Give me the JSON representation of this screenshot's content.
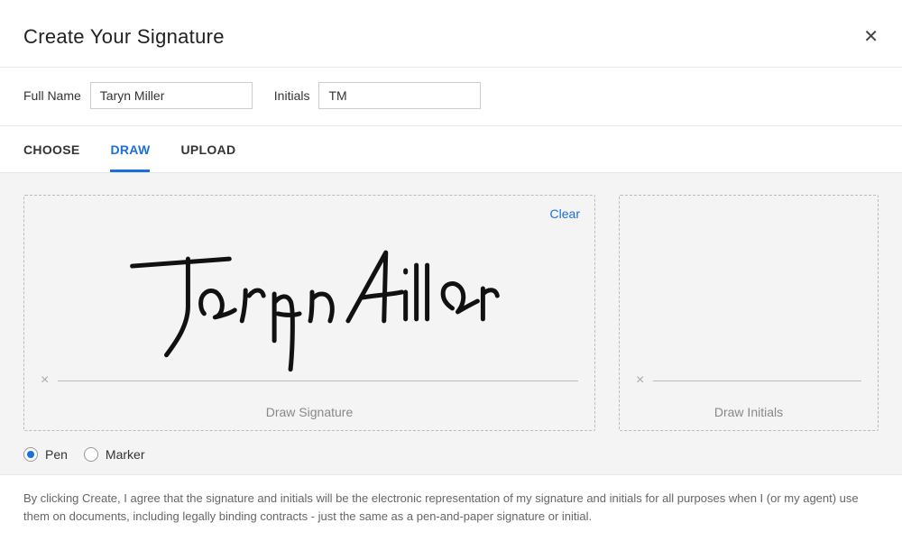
{
  "dialog": {
    "title": "Create Your Signature"
  },
  "fields": {
    "full_name_label": "Full Name",
    "full_name_value": "Taryn Miller",
    "initials_label": "Initials",
    "initials_value": "TM"
  },
  "tabs": {
    "choose": "CHOOSE",
    "draw": "DRAW",
    "upload": "UPLOAD",
    "active": "draw"
  },
  "draw_area": {
    "clear_label": "Clear",
    "signature_caption": "Draw Signature",
    "initials_caption": "Draw Initials",
    "tool_pen": "Pen",
    "tool_marker": "Marker",
    "selected_tool": "pen"
  },
  "footer": {
    "disclaimer": "By clicking Create, I agree that the signature and initials will be the electronic representation of my signature and initials for all purposes when I (or my agent) use them on documents, including legally binding contracts - just the same as a pen-and-paper signature or initial."
  }
}
